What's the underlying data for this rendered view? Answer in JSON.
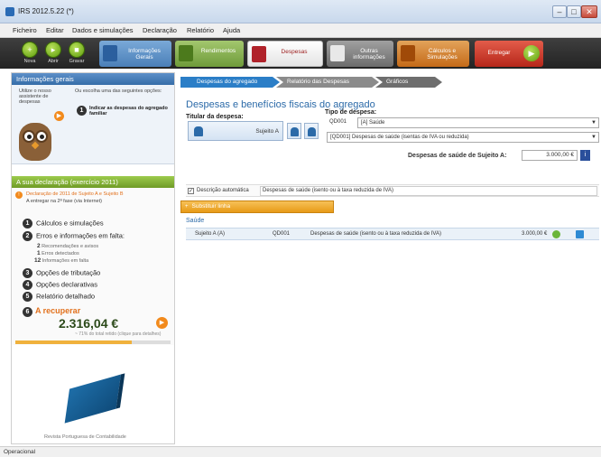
{
  "window": {
    "title": "IRS 2012.5.22 (*)"
  },
  "menu": {
    "items": [
      "Ficheiro",
      "Editar",
      "Dados e simulações",
      "Declaração",
      "Relatório",
      "Ajuda"
    ]
  },
  "toolbar": {
    "nova": "Nova",
    "abrir": "Abrir",
    "gravar": "Gravar",
    "tabs": {
      "info_gerais": "Informações Gerais",
      "rendimentos": "Rendimentos",
      "despesas": "Despesas",
      "outras": "Outras informações",
      "calculos": "Cálculos e Simulações"
    },
    "entregar": "Entregar"
  },
  "left": {
    "info_title": "Informações gerais",
    "info_col1": "Utilize o nosso assistente de despesas",
    "info_col2": "Ou escolha uma das seguintes opções:",
    "info_option": "Indicar as despesas do agregado familiar",
    "decl_title": "A sua declaração (exercício 2011)",
    "decl_line1": "Declaração de 2011 de Sujeito A e Sujeito B",
    "decl_line2": "A entregar na 2ª fase (via Internet)",
    "steps": {
      "s1": "Cálculos e simulações",
      "s2": "Erros e informações em falta:",
      "s2a_n": "2",
      "s2a": "Recomendações e avisos",
      "s2b_n": "1",
      "s2b": "Erros detectados",
      "s2c_n": "12",
      "s2c": "Informações em falta",
      "s3": "Opções de tributação",
      "s4": "Opções declarativas",
      "s5": "Relatório detalhado",
      "s6": "A recuperar"
    },
    "recover_value": "2.316,04 €",
    "recover_note": "~ 71% do total retido (clique para detalhes)",
    "book_caption": "Revista Portuguesa de Contabilidade"
  },
  "main": {
    "crumbs": [
      "Despesas do agregado",
      "Relatório das Despesas",
      "Gráficos"
    ],
    "title": "Despesas e benefícios fiscais do agregado",
    "titular_label": "Titular da despesa:",
    "titular_value": "Sujeito A",
    "tipo_label": "Tipo de despesa:",
    "tipo_code": "QD001",
    "tipo_value": "[A] Saúde",
    "tipo_detail": "[QD001] Despesas de saúde (isentas de IVA ou reduzida)",
    "amount_label": "Despesas de saúde de Sujeito A:",
    "amount_value": "3.000,00 €",
    "auto_desc_label": "Descrição automática",
    "auto_desc_value": "Despesas de saúde (isento ou à taxa reduzida de IVA)",
    "subst_label": "Substituir linha",
    "section": "Saúde",
    "row": {
      "who": "Sujeito A (A)",
      "code": "QD001",
      "desc": "Despesas de saúde (isento ou à taxa reduzida de IVA)",
      "amount": "3.000,00 €"
    }
  },
  "status": {
    "text": "Operacional"
  }
}
